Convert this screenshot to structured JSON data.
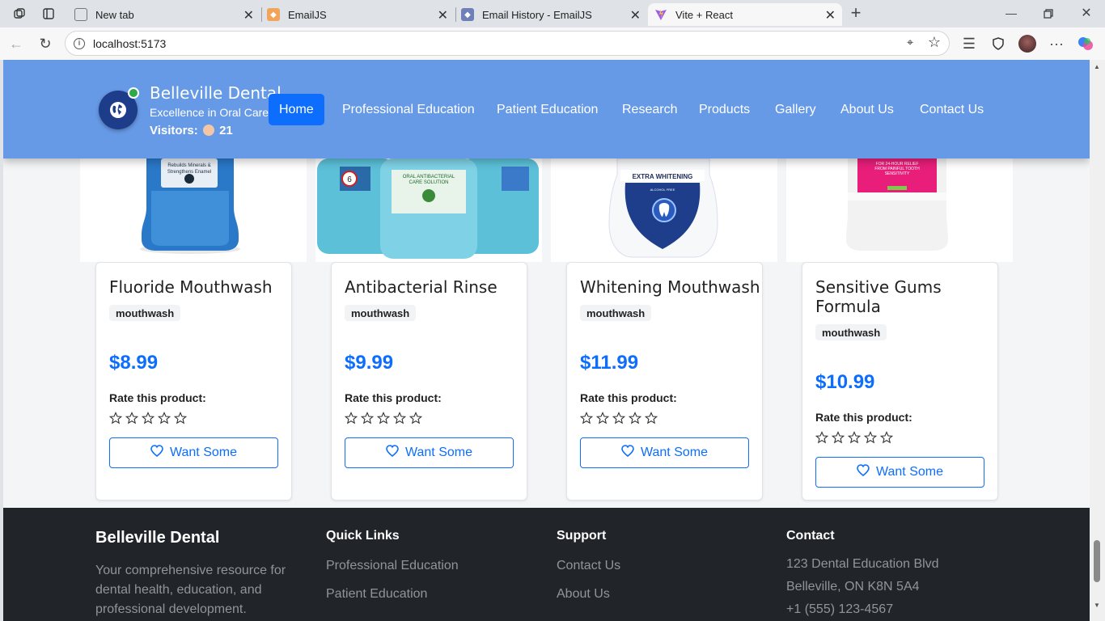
{
  "browser": {
    "tabs": [
      {
        "title": "New tab"
      },
      {
        "title": "EmailJS"
      },
      {
        "title": "Email History - EmailJS"
      },
      {
        "title": "Vite + React"
      }
    ],
    "url": "localhost:5173"
  },
  "header": {
    "brand": "Belleville Dental",
    "tagline": "Excellence in Oral Care",
    "visitors_label": "Visitors:",
    "visitors_count": "21",
    "nav": [
      "Home",
      "Professional Education",
      "Patient Education",
      "Research",
      "Products",
      "Gallery",
      "About Us",
      "Contact Us"
    ],
    "active_nav": "Home"
  },
  "products": [
    {
      "name": "Fluoride Mouthwash",
      "category": "mouthwash",
      "price": "$8.99",
      "rating": 0,
      "label_text": [
        "Rebuilds Minerals &",
        "Strengthens Enamel"
      ]
    },
    {
      "name": "Antibacterial Rinse",
      "category": "mouthwash",
      "price": "$9.99",
      "rating": 0,
      "label_text": [
        "ORAL ANTIBACTERIAL",
        "CARE SOLUTION"
      ]
    },
    {
      "name": "Whitening Mouthwash",
      "category": "mouthwash",
      "price": "$11.99",
      "rating": 0,
      "label_text": [
        "EXTRA WHITENING",
        "ALCOHOL FREE"
      ]
    },
    {
      "name": "Sensitive Gums Formula",
      "category": "mouthwash",
      "price": "$10.99",
      "rating": 0,
      "label_text": [
        "FOR 24-HOUR RELIEF",
        "FROM PAINFUL TOOTH",
        "SENSITIVITY"
      ]
    }
  ],
  "rate_label": "Rate this product:",
  "button_label": "Want Some",
  "footer": {
    "brand": "Belleville Dental",
    "description": [
      "Your comprehensive resource for",
      "dental health, education, and",
      "professional development."
    ],
    "quick_links_title": "Quick Links",
    "quick_links": [
      "Professional Education",
      "Patient Education"
    ],
    "support_title": "Support",
    "support_links": [
      "Contact Us",
      "About Us"
    ],
    "contact_title": "Contact",
    "contact_lines": [
      "123 Dental Education Blvd",
      "Belleville, ON K8N 5A4",
      "+1 (555) 123-4567"
    ]
  },
  "colors": {
    "header": "#6699e6",
    "accent": "#0d6efd",
    "footer": "#212529"
  }
}
